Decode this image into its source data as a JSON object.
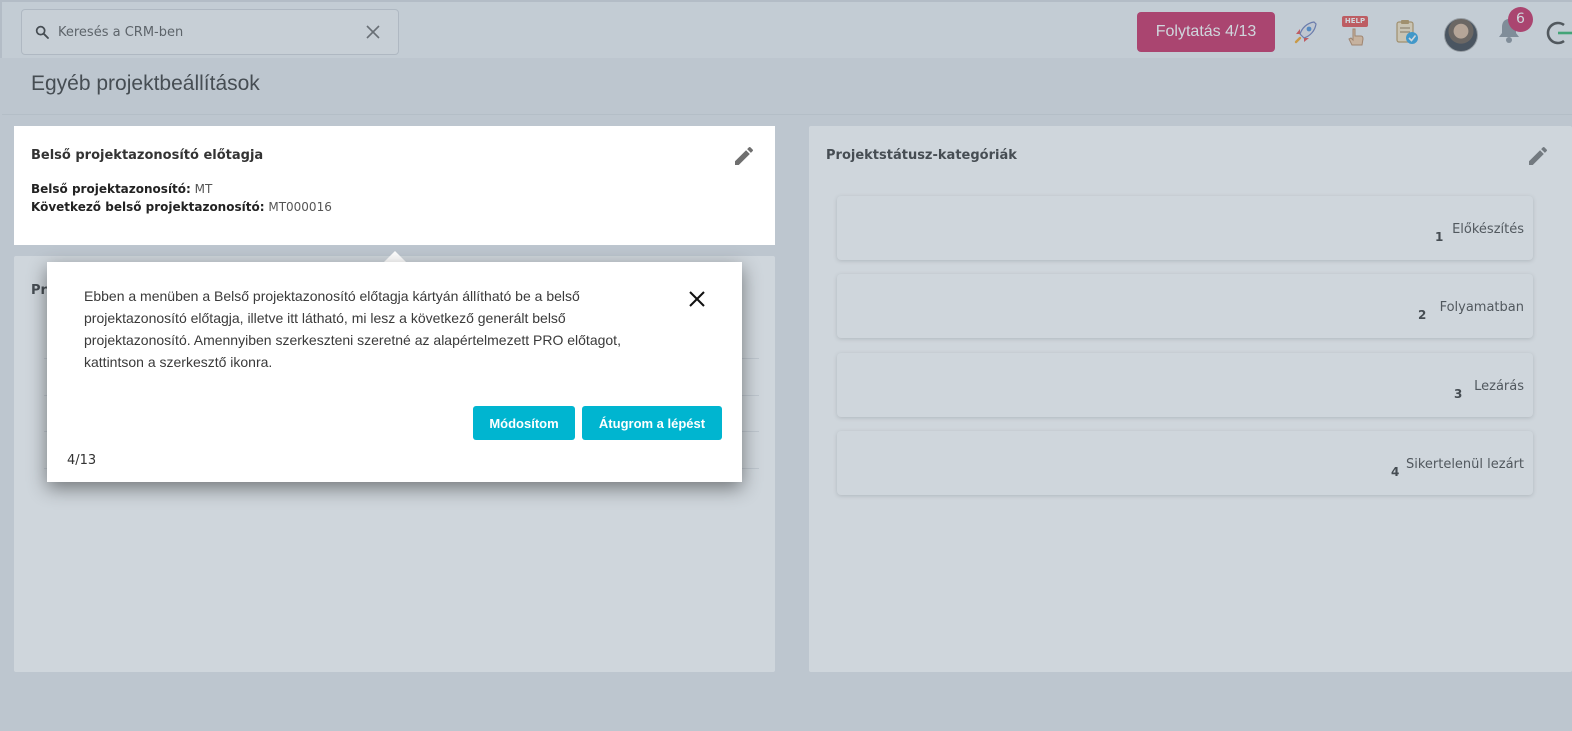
{
  "header": {
    "search_placeholder": "Keresés a CRM-ben",
    "continue_label": "Folytatás 4/13",
    "help_label": "HELP",
    "notification_count": "6"
  },
  "page": {
    "title": "Egyéb projektbeállítások"
  },
  "prefix_card": {
    "title": "Belső projektazonosító előtagja",
    "id_label": "Belső projektazonosító:",
    "id_value": "MT",
    "next_label": "Következő belső projektazonosító:",
    "next_value": "MT000016"
  },
  "second_card": {
    "title_partial": "Pr"
  },
  "status_card": {
    "title": "Projektstátusz-kategóriák",
    "items": [
      {
        "order": "1",
        "name": "Előkészítés"
      },
      {
        "order": "2",
        "name": "Folyamatban"
      },
      {
        "order": "3",
        "name": "Lezárás"
      },
      {
        "order": "4",
        "name": "Sikertelenül lezárt"
      }
    ]
  },
  "tour": {
    "text": "Ebben a menüben a Belső projektazonosító előtagja kártyán állítható be a belső projektazonosító előtagja, illetve itt látható, mi lesz a következő generált belső projektazonosító. Amennyiben szerkeszteni szeretné az alapértelmezett PRO előtagot, kattintson a szerkesztő ikonra.",
    "modify_label": "Módosítom",
    "skip_label": "Átugrom a lépést",
    "step": "4/13"
  },
  "colors": {
    "accent_pink": "#c8275f",
    "accent_cyan": "#00b5d0"
  }
}
